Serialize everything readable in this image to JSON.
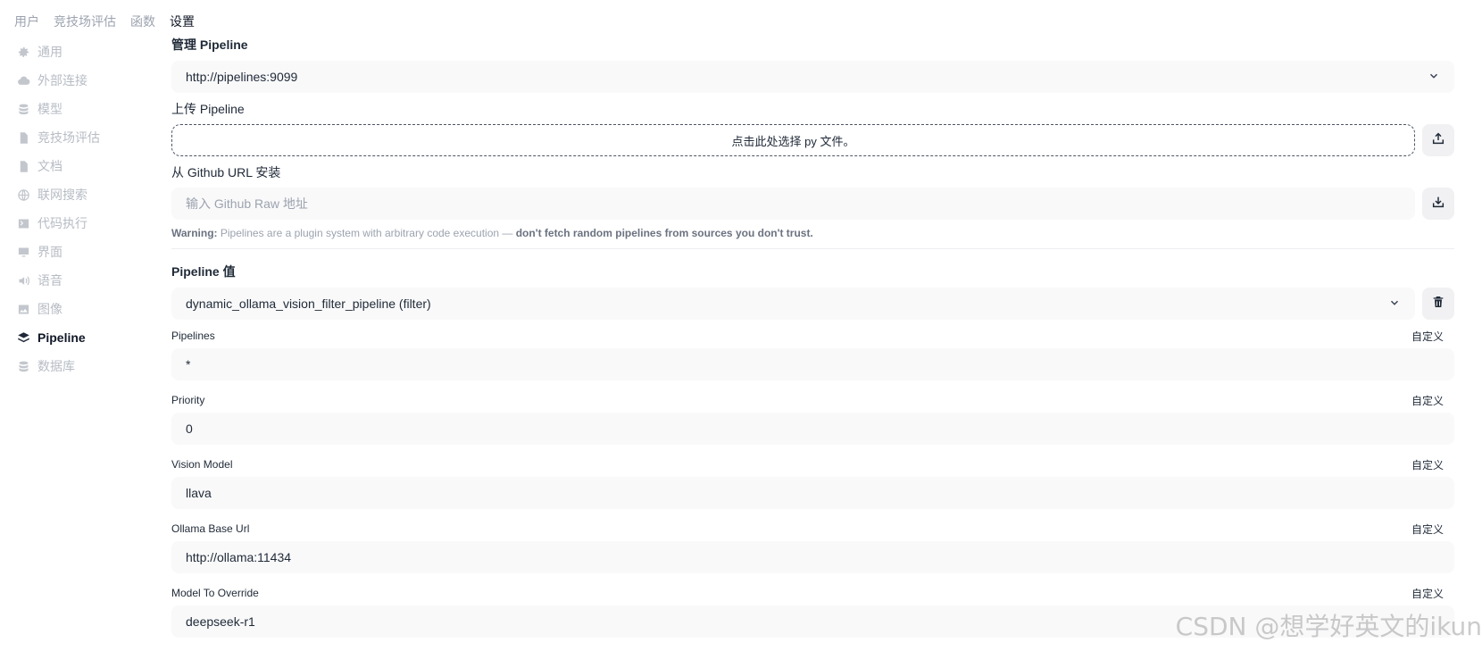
{
  "top_tabs": [
    {
      "label": "用户",
      "active": false
    },
    {
      "label": "竞技场评估",
      "active": false
    },
    {
      "label": "函数",
      "active": false
    },
    {
      "label": "设置",
      "active": true
    }
  ],
  "sidebar": {
    "items": [
      {
        "label": "通用",
        "icon": "gear-icon"
      },
      {
        "label": "外部连接",
        "icon": "cloud-icon"
      },
      {
        "label": "模型",
        "icon": "database-icon"
      },
      {
        "label": "竞技场评估",
        "icon": "document-icon"
      },
      {
        "label": "文档",
        "icon": "file-icon"
      },
      {
        "label": "联网搜索",
        "icon": "globe-icon"
      },
      {
        "label": "代码执行",
        "icon": "terminal-icon"
      },
      {
        "label": "界面",
        "icon": "monitor-icon"
      },
      {
        "label": "语音",
        "icon": "speaker-icon"
      },
      {
        "label": "图像",
        "icon": "image-icon"
      },
      {
        "label": "Pipeline",
        "icon": "layers-icon",
        "active": true
      },
      {
        "label": "数据库",
        "icon": "database-icon"
      }
    ]
  },
  "manage": {
    "title": "管理 Pipeline",
    "selected_url": "http://pipelines:9099"
  },
  "upload": {
    "title": "上传 Pipeline",
    "dropzone_text": "点击此处选择 py 文件。"
  },
  "github": {
    "title": "从 Github URL 安装",
    "placeholder": "输入 Github Raw 地址"
  },
  "warning": {
    "prefix": "Warning:",
    "text": " Pipelines are a plugin system with arbitrary code execution — ",
    "emphasis": "don't fetch random pipelines from sources you don't trust."
  },
  "valves": {
    "title": "Pipeline 值",
    "selected_pipeline": "dynamic_ollama_vision_filter_pipeline (filter)",
    "custom_label": "自定义",
    "fields": [
      {
        "label": "Pipelines",
        "value": "*"
      },
      {
        "label": "Priority",
        "value": "0"
      },
      {
        "label": "Vision Model",
        "value": "llava"
      },
      {
        "label": "Ollama Base Url",
        "value": "http://ollama:11434"
      },
      {
        "label": "Model To Override",
        "value": "deepseek-r1"
      }
    ]
  },
  "watermark": "CSDN @想学好英文的ikun"
}
